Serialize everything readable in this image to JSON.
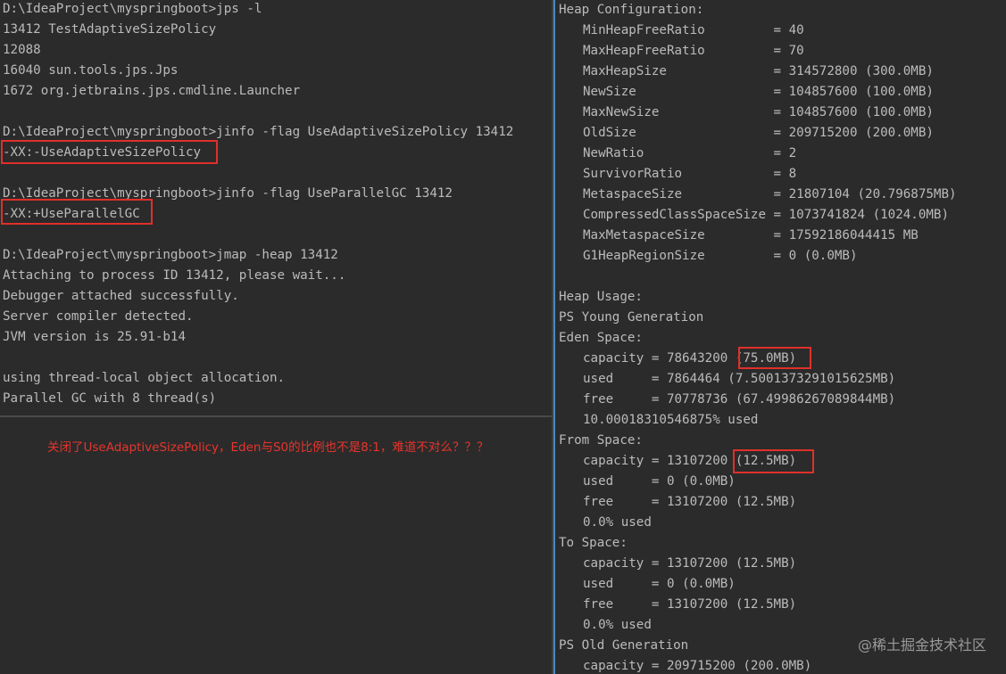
{
  "terminal": {
    "lines": [
      "D:\\IdeaProject\\myspringboot>jps -l",
      "13412 TestAdaptiveSizePolicy",
      "12088",
      "16040 sun.tools.jps.Jps",
      "1672 org.jetbrains.jps.cmdline.Launcher",
      "",
      "D:\\IdeaProject\\myspringboot>jinfo -flag UseAdaptiveSizePolicy 13412",
      "-XX:-UseAdaptiveSizePolicy",
      "",
      "D:\\IdeaProject\\myspringboot>jinfo -flag UseParallelGC 13412",
      "-XX:+UseParallelGC",
      "",
      "D:\\IdeaProject\\myspringboot>jmap -heap 13412",
      "Attaching to process ID 13412, please wait...",
      "Debugger attached successfully.",
      "Server compiler detected.",
      "JVM version is 25.91-b14",
      "",
      "using thread-local object allocation.",
      "Parallel GC with 8 thread(s)"
    ]
  },
  "annotation": {
    "text": "关闭了UseAdaptiveSizePolicy，Eden与S0的比例也不是8:1，难道不对么？？？",
    "color": "#e8342c"
  },
  "heap": {
    "lines": [
      {
        "text": "Heap Configuration:",
        "indent": false
      },
      {
        "text": "MinHeapFreeRatio         = 40",
        "indent": true
      },
      {
        "text": "MaxHeapFreeRatio         = 70",
        "indent": true
      },
      {
        "text": "MaxHeapSize              = 314572800 (300.0MB)",
        "indent": true
      },
      {
        "text": "NewSize                  = 104857600 (100.0MB)",
        "indent": true
      },
      {
        "text": "MaxNewSize               = 104857600 (100.0MB)",
        "indent": true
      },
      {
        "text": "OldSize                  = 209715200 (200.0MB)",
        "indent": true
      },
      {
        "text": "NewRatio                 = 2",
        "indent": true
      },
      {
        "text": "SurvivorRatio            = 8",
        "indent": true
      },
      {
        "text": "MetaspaceSize            = 21807104 (20.796875MB)",
        "indent": true
      },
      {
        "text": "CompressedClassSpaceSize = 1073741824 (1024.0MB)",
        "indent": true
      },
      {
        "text": "MaxMetaspaceSize         = 17592186044415 MB",
        "indent": true
      },
      {
        "text": "G1HeapRegionSize         = 0 (0.0MB)",
        "indent": true
      },
      {
        "text": "",
        "indent": false
      },
      {
        "text": "Heap Usage:",
        "indent": false
      },
      {
        "text": "PS Young Generation",
        "indent": false
      },
      {
        "text": "Eden Space:",
        "indent": false
      },
      {
        "text": "capacity = 78643200 (75.0MB)",
        "indent": true
      },
      {
        "text": "used     = 7864464 (7.5001373291015625MB)",
        "indent": true
      },
      {
        "text": "free     = 70778736 (67.49986267089844MB)",
        "indent": true
      },
      {
        "text": "10.00018310546875% used",
        "indent": true
      },
      {
        "text": "From Space:",
        "indent": false
      },
      {
        "text": "capacity = 13107200 (12.5MB)",
        "indent": true
      },
      {
        "text": "used     = 0 (0.0MB)",
        "indent": true
      },
      {
        "text": "free     = 13107200 (12.5MB)",
        "indent": true
      },
      {
        "text": "0.0% used",
        "indent": true
      },
      {
        "text": "To Space:",
        "indent": false
      },
      {
        "text": "capacity = 13107200 (12.5MB)",
        "indent": true
      },
      {
        "text": "used     = 0 (0.0MB)",
        "indent": true
      },
      {
        "text": "free     = 13107200 (12.5MB)",
        "indent": true
      },
      {
        "text": "0.0% used",
        "indent": true
      },
      {
        "text": "PS Old Generation",
        "indent": false
      },
      {
        "text": "capacity = 209715200 (200.0MB)",
        "indent": true
      }
    ]
  },
  "watermark": {
    "text": "@稀土掘金技术社区"
  },
  "colors": {
    "background": "#2b2b2b",
    "text": "#bbbbbb",
    "highlight_box": "#e0302a",
    "divider_accent": "#4a88c7"
  }
}
